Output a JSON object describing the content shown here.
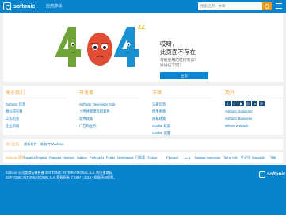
{
  "header": {
    "logo_text": "softonic",
    "nav": [
      "应用",
      "游戏"
    ],
    "search_placeholder": "搜索应用、文章"
  },
  "error": {
    "number": "404",
    "zzz": "zz",
    "title_line1": "哎呀，",
    "title_line2": "此页面不存在",
    "help_line1": "可能使用的链接有误？",
    "help_line2": "试试这个吧：",
    "home_button": "主页"
  },
  "footer": {
    "about": {
      "heading": "关于我们",
      "items": [
        "Softonic 信息",
        "图标和名称",
        "工作机会",
        "企业新闻"
      ]
    },
    "developers": {
      "heading": "开发者",
      "items": [
        "Softonic Developer Hub",
        "上传并管理您的软件",
        "软件政策",
        "广告和业务"
      ]
    },
    "legal": {
      "heading": "法律",
      "items": [
        "法律信息",
        "使用条款",
        "隐私政策",
        "Cookie 政策",
        "Cookie 设置"
      ]
    },
    "users": {
      "heading": "用户",
      "items": [
        "Softonic Solutions",
        "Softonic Business",
        "Where 2 Watch"
      ]
    }
  },
  "popular": {
    "label": "热门应用",
    "links": [
      "最新软件",
      "新软件Windows"
    ]
  },
  "languages": [
    {
      "label": "Softonic 语言:",
      "active": true
    },
    {
      "label": "Español"
    },
    {
      "label": "English"
    },
    {
      "label": "Français"
    },
    {
      "label": "Deutsch"
    },
    {
      "label": "Italiano"
    },
    {
      "label": "Português"
    },
    {
      "label": "Polski"
    },
    {
      "label": "Nederlands"
    },
    {
      "label": "日本語"
    },
    {
      "label": "Türkçe"
    },
    {
      "label": "Русский"
    },
    {
      "label": "عربي"
    },
    {
      "label": "Bahasa Indonesia"
    },
    {
      "label": "Tiếng Việt"
    },
    {
      "label": "한국어"
    },
    {
      "label": "Kiswahili"
    },
    {
      "label": "ไทย"
    }
  ],
  "copyright": {
    "line1": "Softonic 公司是商标持有者 SOFTONIC INTERNATIONAL S.A. 的注册商标",
    "line2": "SOFTONIC INTERNATIONAL S.A. 版权所有 © 1997 - 2019 - 保留所有权利。"
  },
  "colors": {
    "brand": "#0a83cf",
    "accent": "#f2a33a"
  }
}
